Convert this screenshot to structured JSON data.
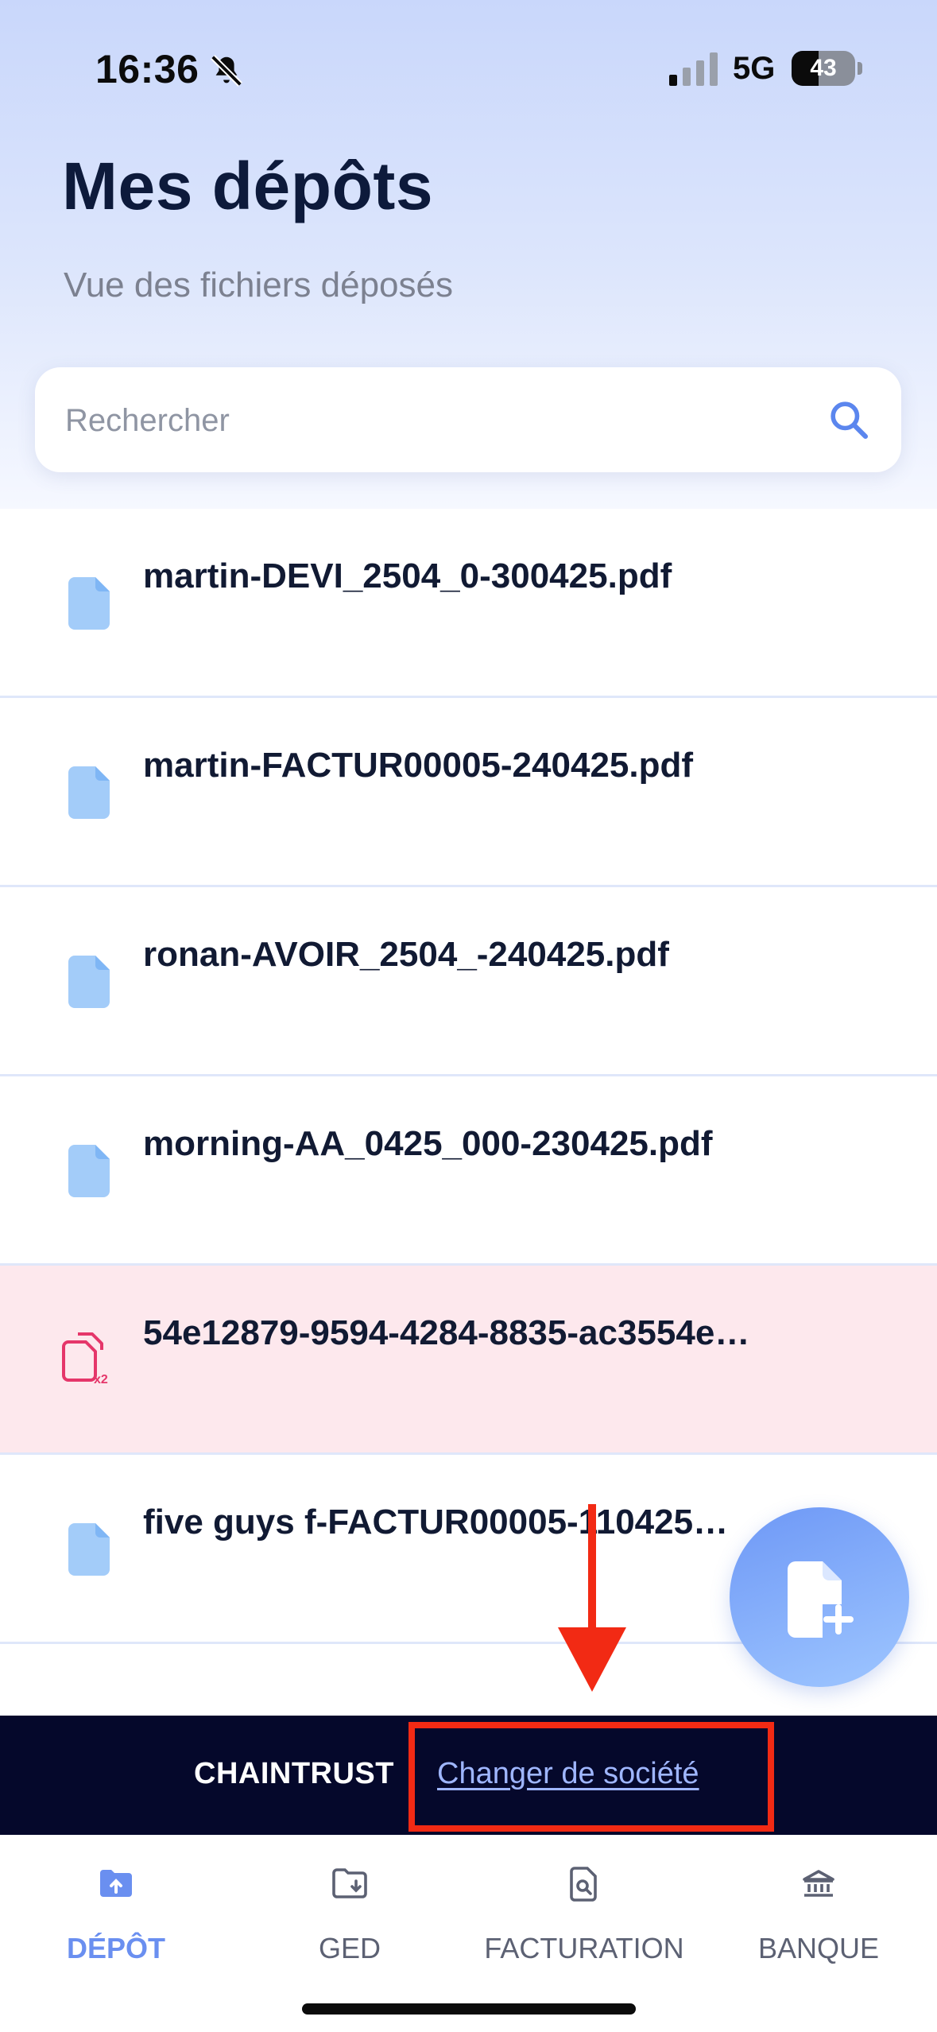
{
  "status_bar": {
    "time": "16:36",
    "network": "5G",
    "battery": "43",
    "battery_level": 0.43
  },
  "header": {
    "title": "Mes dépôts",
    "subtitle": "Vue des fichiers déposés"
  },
  "search": {
    "placeholder": "Rechercher",
    "value": ""
  },
  "files": [
    {
      "name": "martin-DEVI_2504_0-300425.pdf",
      "status": "ok"
    },
    {
      "name": "martin-FACTUR00005-240425.pdf",
      "status": "ok"
    },
    {
      "name": "ronan-AVOIR_2504_-240425.pdf",
      "status": "ok"
    },
    {
      "name": "morning-AA_0425_000-230425.pdf",
      "status": "ok"
    },
    {
      "name": "54e12879-9594-4284-8835-ac3554e…",
      "status": "duplicate"
    },
    {
      "name": "five guys f-FACTUR00005-110425…",
      "status": "ok"
    }
  ],
  "company_bar": {
    "company": "CHAINTRUST",
    "change_link": "Changer de société"
  },
  "tabs": [
    {
      "label": "DÉPÔT",
      "icon": "folder-upload-icon",
      "active": true
    },
    {
      "label": "GED",
      "icon": "folder-download-icon",
      "active": false
    },
    {
      "label": "FACTURATION",
      "icon": "invoice-search-icon",
      "active": false
    },
    {
      "label": "BANQUE",
      "icon": "bank-icon",
      "active": false
    }
  ],
  "colors": {
    "accent": "#6a8ff0",
    "title": "#0d1a3b",
    "error_row": "#fde8ed",
    "error_icon": "#e5366a",
    "file_icon": "#a3ccf9",
    "company_bar": "#05082b",
    "annotation": "#f22a14"
  }
}
